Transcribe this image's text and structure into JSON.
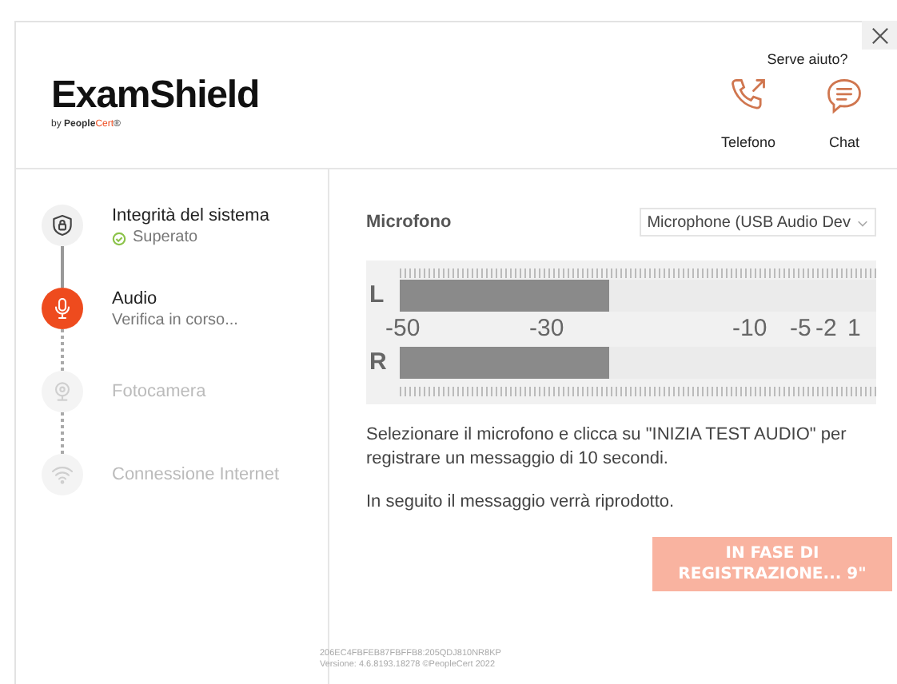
{
  "header": {
    "logo": "ExamShield",
    "byline": {
      "prefix": "by",
      "brand": "People",
      "brand_accent": "Cert",
      "mark": "®"
    },
    "help_title": "Serve aiuto?",
    "help": [
      {
        "kind": "phone",
        "label": "Telefono"
      },
      {
        "kind": "chat",
        "label": "Chat"
      }
    ]
  },
  "steps": [
    {
      "kind": "shield",
      "title": "Integrità del sistema",
      "completed": true,
      "current": false,
      "note": "Superato"
    },
    {
      "kind": "mic",
      "title": "Audio",
      "completed": false,
      "current": true,
      "note": "Verifica in corso..."
    },
    {
      "kind": "camera",
      "title": "Fotocamera",
      "completed": false,
      "current": false
    },
    {
      "kind": "wifi",
      "title": "Connessione Internet",
      "completed": false,
      "current": false
    }
  ],
  "audio": {
    "title": "Microfono",
    "device": "Microphone (USB Audio Dev",
    "channels": [
      {
        "label": "L",
        "level": 0.44
      },
      {
        "label": "R",
        "level": 0.44
      }
    ],
    "scale": [
      "-50",
      "-30",
      "-10",
      "-5",
      "-2",
      "1"
    ],
    "instructions": [
      "Selezionare il microfono e clicca su \"INIZIA TEST AUDIO\" per registrare un messaggio di 10 secondi.",
      "In seguito il messaggio verrà riprodotto."
    ],
    "button": {
      "label": "IN FASE DI REGISTRAZIONE... 9\"",
      "disabled": true
    }
  },
  "footer": [
    "206EC4FBFEB87FBFFB8:205QDJ810NR8KP",
    "Versione: 4.6.8193.18278 ©PeopleCert 2022"
  ]
}
